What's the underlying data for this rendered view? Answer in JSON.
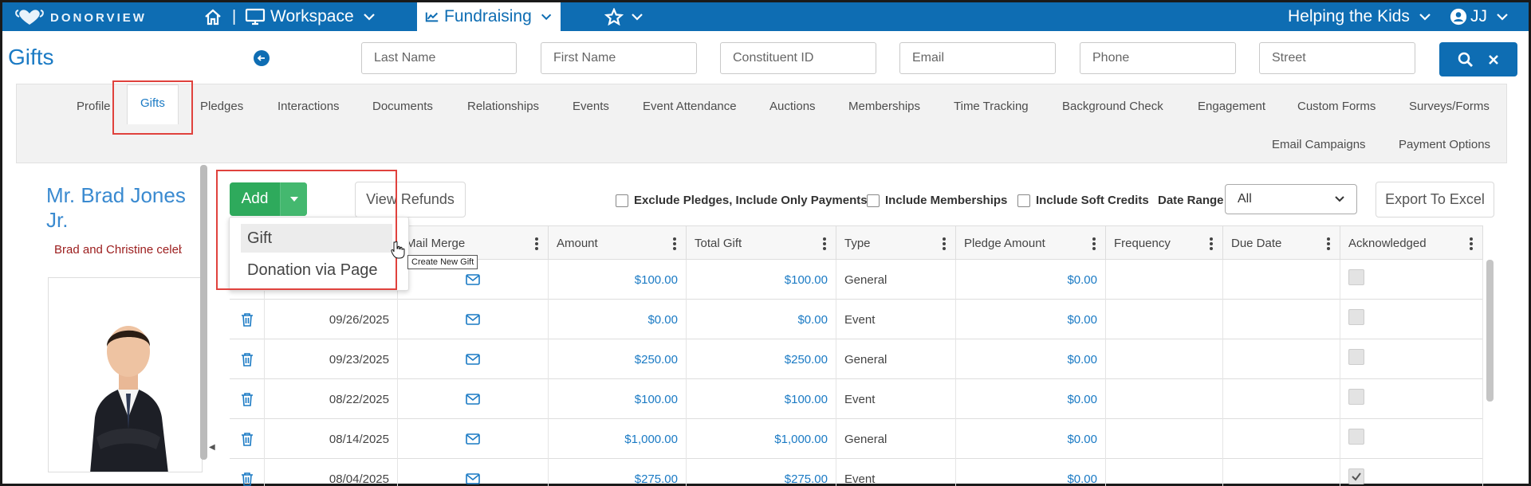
{
  "brand": {
    "name": "DONORVIEW"
  },
  "topnav": {
    "workspace_label": "Workspace",
    "fundraising_label": "Fundraising",
    "org_label": "Helping the Kids",
    "user_initials": "JJ"
  },
  "page": {
    "title": "Gifts"
  },
  "search": {
    "last_name": "Last Name",
    "first_name": "First Name",
    "constituent_id": "Constituent ID",
    "email": "Email",
    "phone": "Phone",
    "street": "Street"
  },
  "tabs": [
    "Profile",
    "Gifts",
    "Pledges",
    "Interactions",
    "Documents",
    "Relationships",
    "Events",
    "Event Attendance",
    "Auctions",
    "Memberships",
    "Time Tracking",
    "Background Check",
    "Engagement",
    "Custom Forms",
    "Surveys/Forms",
    "Email Campaigns",
    "Payment Options"
  ],
  "active_tab": "Gifts",
  "profile": {
    "name": "Mr. Brad Jones Jr.",
    "subtitle": "Brad and Christine celebrate"
  },
  "toolbar": {
    "add_label": "Add",
    "view_refunds_label": "View Refunds",
    "exclude_pledges_label": "Exclude Pledges, Include Only Payments",
    "include_memberships_label": "Include Memberships",
    "include_soft_credits_label": "Include Soft Credits",
    "date_range_label": "Date Range",
    "date_range_value": "All",
    "export_label": "Export To Excel"
  },
  "add_menu": {
    "items": [
      "Gift",
      "Donation via Page"
    ],
    "tooltip": "Create New Gift"
  },
  "grid": {
    "columns": [
      "Mail Merge",
      "Amount",
      "Total Gift",
      "Type",
      "Pledge Amount",
      "Frequency",
      "Due Date",
      "Acknowledged"
    ],
    "rows": [
      {
        "date": "",
        "amount": "$100.00",
        "total_gift": "$100.00",
        "type": "General",
        "pledge_amount": "$0.00",
        "acknowledged": false
      },
      {
        "date": "09/26/2025",
        "amount": "$0.00",
        "total_gift": "$0.00",
        "type": "Event",
        "pledge_amount": "$0.00",
        "acknowledged": false
      },
      {
        "date": "09/23/2025",
        "amount": "$250.00",
        "total_gift": "$250.00",
        "type": "General",
        "pledge_amount": "$0.00",
        "acknowledged": false
      },
      {
        "date": "08/22/2025",
        "amount": "$100.00",
        "total_gift": "$100.00",
        "type": "Event",
        "pledge_amount": "$0.00",
        "acknowledged": false
      },
      {
        "date": "08/14/2025",
        "amount": "$1,000.00",
        "total_gift": "$1,000.00",
        "type": "General",
        "pledge_amount": "$0.00",
        "acknowledged": false
      },
      {
        "date": "08/04/2025",
        "amount": "$275.00",
        "total_gift": "$275.00",
        "type": "Event",
        "pledge_amount": "$0.00",
        "acknowledged": true
      }
    ]
  },
  "colors": {
    "primary": "#0e6db3",
    "add_green": "#2eaa5c",
    "highlight_red": "#e0423d",
    "link": "#1a7ac4"
  }
}
